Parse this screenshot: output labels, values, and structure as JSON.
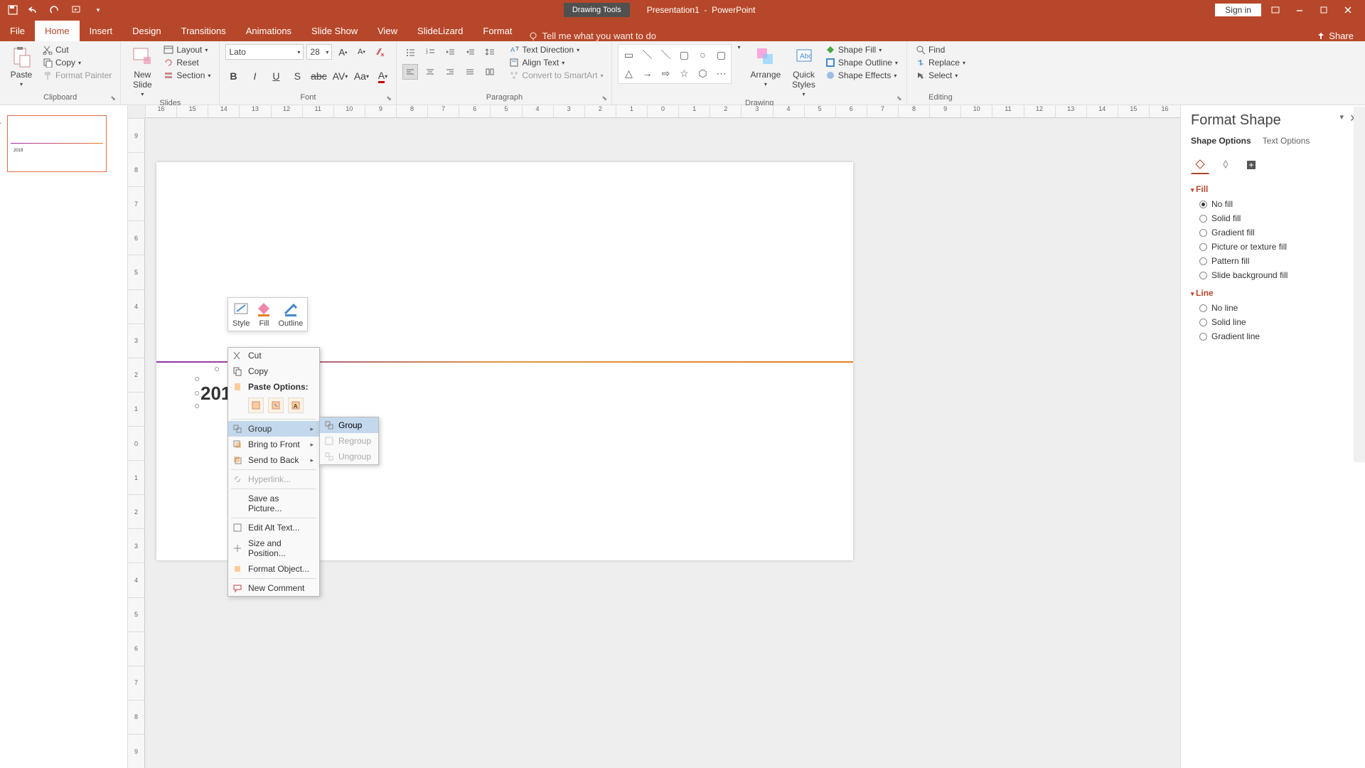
{
  "titlebar": {
    "drawing_tools": "Drawing Tools",
    "doc_name": "Presentation1",
    "app_name": "PowerPoint",
    "sign_in": "Sign in"
  },
  "tabs": {
    "file": "File",
    "home": "Home",
    "insert": "Insert",
    "design": "Design",
    "transitions": "Transitions",
    "animations": "Animations",
    "slideshow": "Slide Show",
    "view": "View",
    "slidelizard": "SlideLizard",
    "format": "Format",
    "tellme": "Tell me what you want to do",
    "share": "Share"
  },
  "ribbon": {
    "clipboard": {
      "label": "Clipboard",
      "paste": "Paste",
      "cut": "Cut",
      "copy": "Copy",
      "format_painter": "Format Painter"
    },
    "slides": {
      "label": "Slides",
      "new_slide": "New\nSlide",
      "layout": "Layout",
      "reset": "Reset",
      "section": "Section"
    },
    "font": {
      "label": "Font",
      "name": "Lato",
      "size": "28"
    },
    "paragraph": {
      "label": "Paragraph",
      "text_direction": "Text Direction",
      "align_text": "Align Text",
      "smartart": "Convert to SmartArt"
    },
    "drawing": {
      "label": "Drawing",
      "arrange": "Arrange",
      "quick_styles": "Quick\nStyles",
      "shape_fill": "Shape Fill",
      "shape_outline": "Shape Outline",
      "shape_effects": "Shape Effects"
    },
    "editing": {
      "label": "Editing",
      "find": "Find",
      "replace": "Replace",
      "select": "Select"
    }
  },
  "hruler": [
    "16",
    "15",
    "14",
    "13",
    "12",
    "11",
    "10",
    "9",
    "8",
    "7",
    "6",
    "5",
    "4",
    "3",
    "2",
    "1",
    "0",
    "1",
    "2",
    "3",
    "4",
    "5",
    "6",
    "7",
    "8",
    "9",
    "10",
    "11",
    "12",
    "13",
    "14",
    "15",
    "16"
  ],
  "vruler": [
    "9",
    "8",
    "7",
    "6",
    "5",
    "4",
    "3",
    "2",
    "1",
    "0",
    "1",
    "2",
    "3",
    "4",
    "5",
    "6",
    "7",
    "8",
    "9"
  ],
  "slide": {
    "number": "1",
    "text": "2019"
  },
  "mini_toolbar": {
    "style": "Style",
    "fill": "Fill",
    "outline": "Outline"
  },
  "context_menu": {
    "cut": "Cut",
    "copy": "Copy",
    "paste_options": "Paste Options:",
    "group": "Group",
    "bring_front": "Bring to Front",
    "send_back": "Send to Back",
    "hyperlink": "Hyperlink...",
    "save_picture": "Save as Picture...",
    "edit_alt": "Edit Alt Text...",
    "size_pos": "Size and Position...",
    "format_obj": "Format Object...",
    "new_comment": "New Comment"
  },
  "submenu": {
    "group": "Group",
    "regroup": "Regroup",
    "ungroup": "Ungroup"
  },
  "pane": {
    "title": "Format Shape",
    "shape_options": "Shape Options",
    "text_options": "Text Options",
    "fill_hdr": "Fill",
    "no_fill": "No fill",
    "solid_fill": "Solid fill",
    "gradient_fill": "Gradient fill",
    "picture_fill": "Picture or texture fill",
    "pattern_fill": "Pattern fill",
    "slide_bg_fill": "Slide background fill",
    "line_hdr": "Line",
    "no_line": "No line",
    "solid_line": "Solid line",
    "gradient_line": "Gradient line"
  }
}
